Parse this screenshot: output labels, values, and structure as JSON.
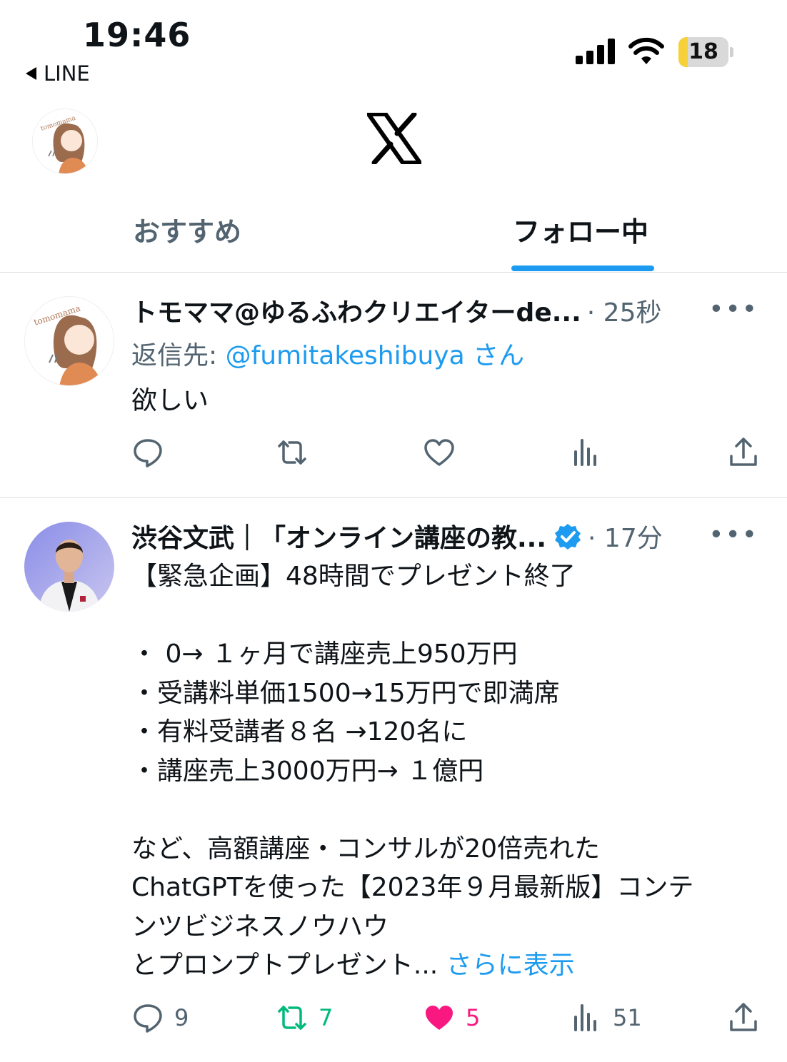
{
  "status": {
    "time": "19:46",
    "back_app": "LINE",
    "battery": "18",
    "battery_level": 0.18,
    "colors": {
      "battery_fill": "#f7d13a"
    }
  },
  "header": {
    "logo": "x-logo-icon",
    "avatar_icon": "profile-avatar-icon"
  },
  "tabs": {
    "recommended": "おすすめ",
    "following": "フォロー中",
    "active": "following",
    "accent": "#1d9bf0"
  },
  "tweets": [
    {
      "author": "トモママ@ゆるふわクリエイターde...",
      "time": "· 25秒",
      "reply_prefix": "返信先: ",
      "reply_handle": "@fumitakeshibuya",
      "reply_suffix": " さん",
      "text": "欲しい",
      "actions": {
        "reply": "",
        "retweet": "",
        "like": "",
        "views": ""
      }
    },
    {
      "author": "渋谷文武｜「オンライン講座の教...",
      "verified": true,
      "time": "· 17分",
      "text": "【緊急企画】48時間でプレゼント終了\n\n・ 0→ １ヶ月で講座売上950万円\n・受講料単価1500→15万円で即満席\n・有料受講者８名 →120名に\n・講座売上3000万円→ １億円\n\nなど、高額講座・コンサルが20倍売れた\nChatGPTを使った【2023年９月最新版】コンテ\nンツビジネスノウハウ\nとプロンプトプレゼント... ",
      "show_more": "さらに表示",
      "actions": {
        "reply": "9",
        "retweet": "7",
        "like": "5",
        "views": "51"
      },
      "colors": {
        "retweet": "#00ba7c",
        "like": "#f91880"
      }
    }
  ]
}
